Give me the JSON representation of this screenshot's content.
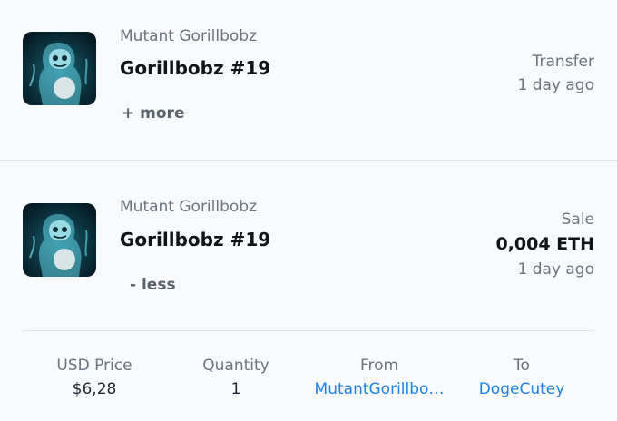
{
  "events": [
    {
      "collection": "Mutant Gorillbobz",
      "item_name": "Gorillbobz #19",
      "toggle_label": "+ more",
      "event_type": "Transfer",
      "time": "1 day ago",
      "image_icon": "gorilla-nft-thumbnail"
    },
    {
      "collection": "Mutant Gorillbobz",
      "item_name": "Gorillbobz #19",
      "toggle_label": "- less",
      "event_type": "Sale",
      "price": "0,004 ETH",
      "time": "1 day ago",
      "image_icon": "gorilla-nft-thumbnail",
      "details": {
        "usd_price_label": "USD Price",
        "usd_price_value": "$6,28",
        "quantity_label": "Quantity",
        "quantity_value": "1",
        "from_label": "From",
        "from_value": "MutantGorillbo…",
        "to_label": "To",
        "to_value": "DogeCutey"
      }
    }
  ],
  "colors": {
    "background": "#f8fafc",
    "link": "#2081e2",
    "muted_text": "#6b7580",
    "divider": "#dde2e8"
  }
}
